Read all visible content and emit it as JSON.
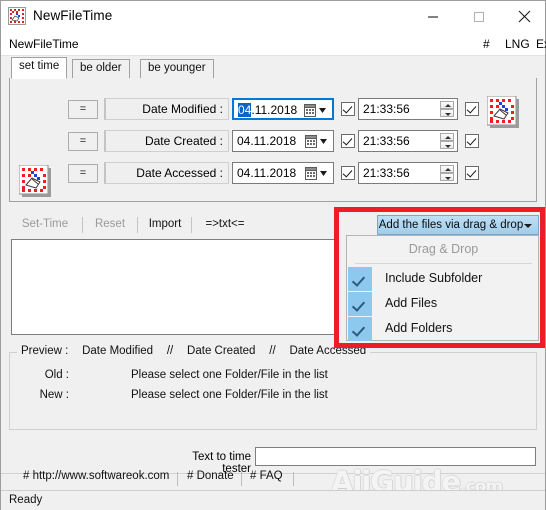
{
  "window": {
    "title": "NewFileTime",
    "icon": "app-clock-grid-icon",
    "controls": {
      "minimize": "minimize-icon",
      "maximize": "maximize-icon",
      "close": "close-icon"
    }
  },
  "menubar": {
    "left_label": "NewFileTime",
    "hash": "#",
    "lng": "LNG",
    "exit": "Exit"
  },
  "tabs": [
    {
      "label": "set time",
      "active": true
    },
    {
      "label": "be older",
      "active": false
    },
    {
      "label": "be younger",
      "active": false
    }
  ],
  "date_rows": [
    {
      "equals_button": "=",
      "label": "Date Modified :",
      "date_value_selected": "04",
      "date_value_rest": ".11.2018",
      "date_checkbox": true,
      "time_value": "21:33:56",
      "time_checkbox": true,
      "focused": true
    },
    {
      "equals_button": "=",
      "label": "Date Created :",
      "date_value_selected": "",
      "date_value_rest": "04.11.2018",
      "date_checkbox": true,
      "time_value": "21:33:56",
      "time_checkbox": true,
      "focused": false
    },
    {
      "equals_button": "=",
      "label": "Date Accessed :",
      "date_value_selected": "",
      "date_value_rest": "04.11.2018",
      "date_checkbox": true,
      "time_value": "21:33:56",
      "time_checkbox": true,
      "focused": false
    }
  ],
  "toolbar": [
    {
      "label": "Set-Time",
      "disabled": true
    },
    {
      "label": "Reset",
      "disabled": true
    },
    {
      "label": "Import",
      "disabled": false
    },
    {
      "label": "=>txt<=",
      "disabled": false
    }
  ],
  "dropdown": {
    "button_label": "Add the files via drag & drop",
    "button_color": "#9fcdeb",
    "header": "Drag & Drop",
    "items": [
      {
        "label": "Include Subfolder",
        "checked": true
      },
      {
        "label": "Add Files",
        "checked": true
      },
      {
        "label": "Add Folders",
        "checked": true
      }
    ]
  },
  "annotation": {
    "color": "#ee1c25"
  },
  "preview": {
    "legend_prefix": "Preview :",
    "legend_items": [
      "Date Modified",
      "Date Created",
      "Date Accessed"
    ],
    "legend_separator": "//",
    "rows": [
      {
        "label": "Old :",
        "value": "Please select one Folder/File in the list"
      },
      {
        "label": "New :",
        "value": "Please select one Folder/File in the list"
      }
    ]
  },
  "time_tester": {
    "label": "Text to time tester",
    "value": "",
    "placeholder": ""
  },
  "links": [
    {
      "label": "# http://www.softwareok.com"
    },
    {
      "label": "# Donate"
    },
    {
      "label": "# FAQ"
    }
  ],
  "watermark": {
    "name": "AiiGuide",
    "suffix": ".com"
  },
  "statusbar": {
    "text": "Ready"
  }
}
